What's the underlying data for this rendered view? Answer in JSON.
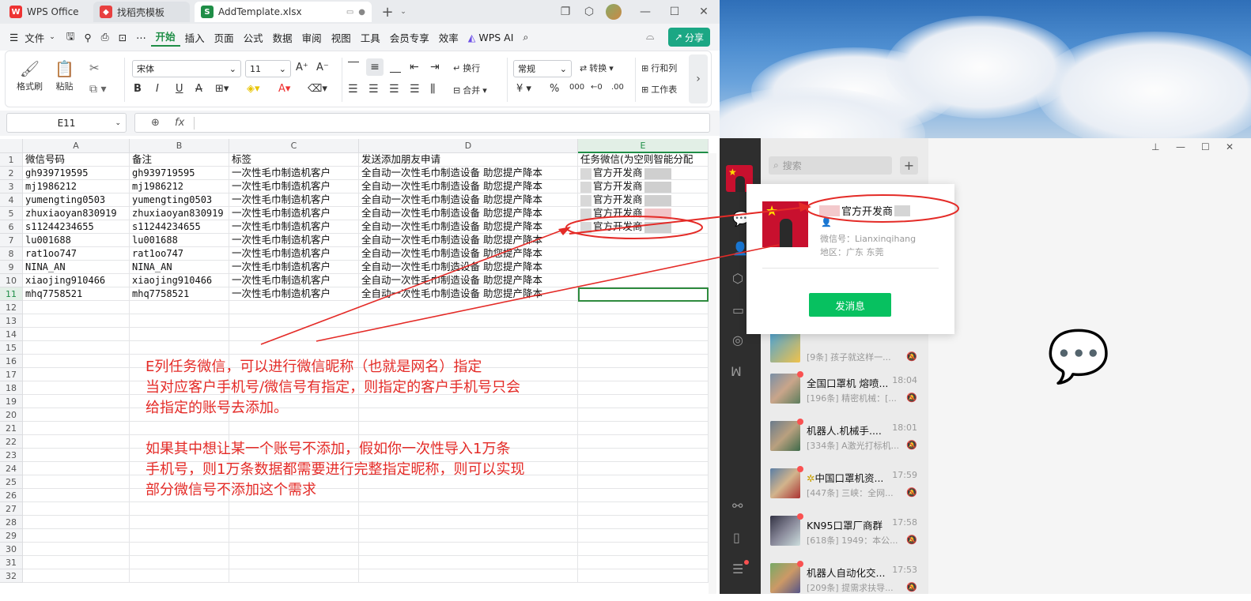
{
  "wps": {
    "tabs": [
      {
        "label": "WPS Office"
      },
      {
        "label": "找稻壳模板"
      },
      {
        "label": "AddTemplate.xlsx"
      }
    ],
    "menu": [
      "文件",
      "开始",
      "插入",
      "页面",
      "公式",
      "数据",
      "审阅",
      "视图",
      "工具",
      "会员专享",
      "效率"
    ],
    "wps_ai": "WPS AI",
    "share": "分享",
    "ribbon": {
      "format_painter": "格式刷",
      "paste": "粘贴",
      "font_name": "宋体",
      "font_size": "11",
      "wrap": "换行",
      "merge": "合并",
      "number_format": "常规",
      "convert": "转换",
      "rows_cols": "行和列",
      "worksheet": "工作表"
    },
    "name_box": "E11",
    "fx": "fx",
    "columns": [
      "A",
      "B",
      "C",
      "D",
      "E"
    ],
    "rows": [
      "1",
      "2",
      "3",
      "4",
      "5",
      "6",
      "7",
      "8",
      "9",
      "10",
      "11",
      "12",
      "13",
      "14",
      "15",
      "16",
      "17",
      "18",
      "19",
      "20",
      "21",
      "22",
      "23",
      "24",
      "25",
      "26",
      "27",
      "28",
      "29",
      "30",
      "31",
      "32"
    ],
    "header_row": [
      "微信号码",
      "备注",
      "标签",
      "发送添加朋友申请",
      "任务微信(为空则智能分配"
    ],
    "data_rows": [
      [
        "gh939719595",
        "gh939719595",
        "一次性毛巾制造机客户",
        "全自动一次性毛巾制造设备 助您提产降本",
        "官方开发商"
      ],
      [
        "mj1986212",
        "mj1986212",
        "一次性毛巾制造机客户",
        "全自动一次性毛巾制造设备 助您提产降本",
        "官方开发商"
      ],
      [
        "yumengting0503",
        "yumengting0503",
        "一次性毛巾制造机客户",
        "全自动一次性毛巾制造设备 助您提产降本",
        "官方开发商"
      ],
      [
        "zhuxiaoyan830919",
        "zhuxiaoyan830919",
        "一次性毛巾制造机客户",
        "全自动一次性毛巾制造设备 助您提产降本",
        "官方开发商"
      ],
      [
        "s11244234655",
        "s11244234655",
        "一次性毛巾制造机客户",
        "全自动一次性毛巾制造设备 助您提产降本",
        "官方开发商"
      ],
      [
        "lu001688",
        "lu001688",
        "一次性毛巾制造机客户",
        "全自动一次性毛巾制造设备 助您提产降本",
        ""
      ],
      [
        "rat1oo747",
        "rat1oo747",
        "一次性毛巾制造机客户",
        "全自动一次性毛巾制造设备 助您提产降本",
        ""
      ],
      [
        "NINA_AN",
        "NINA_AN",
        "一次性毛巾制造机客户",
        "全自动一次性毛巾制造设备 助您提产降本",
        ""
      ],
      [
        "xiaojing910466",
        "xiaojing910466",
        "一次性毛巾制造机客户",
        "全自动一次性毛巾制造设备 助您提产降本",
        ""
      ],
      [
        "mhq7758521",
        "mhq7758521",
        "一次性毛巾制造机客户",
        "全自动一次性毛巾制造设备 助您提产降本",
        ""
      ]
    ],
    "annotation": [
      "E列任务微信，可以进行微信昵称（也就是网名）指定",
      "当对应客户手机号/微信号有指定，则指定的客户手机号只会",
      "给指定的账号去添加。",
      "",
      "如果其中想让某一个账号不添加，假如你一次性导入1万条",
      "手机号，则1万条数据都需要进行完整指定昵称，则可以实现",
      "部分微信号不添加这个需求"
    ],
    "colors": {
      "accent": "#1f8e47",
      "annotation": "#e42b27",
      "selection": "#2e8b3e"
    }
  },
  "wechat": {
    "search_placeholder": "搜索",
    "profile": {
      "name": "官方开发商",
      "wechat_id": "微信号：Lianxinqihang",
      "region": "地区：广东 东莞",
      "send_button": "发消息"
    },
    "chats": [
      {
        "name": "",
        "time": "",
        "preview": "[9条] 孩子就这样一..."
      },
      {
        "name": "全国口罩机 熔喷...",
        "time": "18:04",
        "preview": "[196条] 精密机械：[..."
      },
      {
        "name": "机器人.机械手....",
        "time": "18:01",
        "preview": "[334条] A激光打标机..."
      },
      {
        "name": "中国口罩机资...",
        "time": "17:59",
        "preview": "[447条] 三峡：全网..."
      },
      {
        "name": "KN95口罩厂商群",
        "time": "17:58",
        "preview": "[618条] 1949：本公..."
      },
      {
        "name": "机器人自动化交...",
        "time": "17:53",
        "preview": "[209条] 提需求扶导..."
      }
    ],
    "colors": {
      "send": "#07c160",
      "sidebar": "#2e2e2e"
    }
  }
}
